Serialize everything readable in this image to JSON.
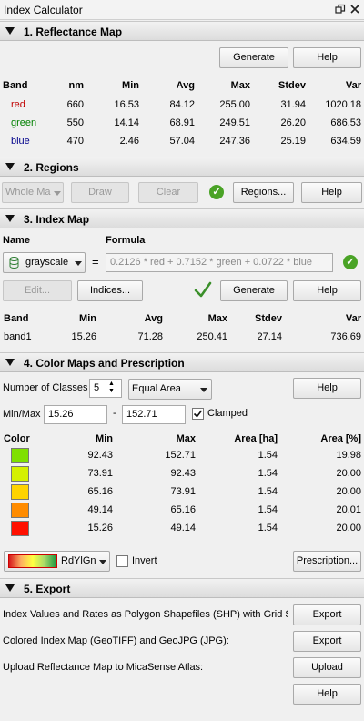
{
  "window": {
    "title": "Index Calculator",
    "restore_icon": "restore-icon",
    "close_icon": "close-icon"
  },
  "s1": {
    "header": "1. Reflectance Map",
    "generate": "Generate",
    "help": "Help",
    "columns": [
      "Band",
      "nm",
      "Min",
      "Avg",
      "Max",
      "Stdev",
      "Var"
    ],
    "rows": [
      {
        "band": "red",
        "color": "#c00000",
        "nm": "660",
        "min": "16.53",
        "avg": "84.12",
        "max": "255.00",
        "stdev": "31.94",
        "var": "1020.18"
      },
      {
        "band": "green",
        "color": "#008000",
        "nm": "550",
        "min": "14.14",
        "avg": "68.91",
        "max": "249.51",
        "stdev": "26.20",
        "var": "686.53"
      },
      {
        "band": "blue",
        "color": "#00008b",
        "nm": "470",
        "min": "2.46",
        "avg": "57.04",
        "max": "247.36",
        "stdev": "25.19",
        "var": "634.59"
      }
    ]
  },
  "s2": {
    "header": "2. Regions",
    "region_select": "Whole Ma",
    "draw": "Draw",
    "clear": "Clear",
    "regions": "Regions...",
    "help": "Help"
  },
  "s3": {
    "header": "3. Index Map",
    "name_label": "Name",
    "formula_label": "Formula",
    "name_value": "grayscale",
    "equals": "=",
    "formula": "0.2126 * red + 0.7152 * green + 0.0722 * blue",
    "edit": "Edit...",
    "indices": "Indices...",
    "generate": "Generate",
    "help": "Help",
    "columns": [
      "Band",
      "Min",
      "Avg",
      "Max",
      "Stdev",
      "Var"
    ],
    "row": {
      "band": "band1",
      "min": "15.26",
      "avg": "71.28",
      "max": "250.41",
      "stdev": "27.14",
      "var": "736.69"
    }
  },
  "s4": {
    "header": "4. Color Maps and Prescription",
    "classes_label": "Number of Classes",
    "classes_value": "5",
    "method": "Equal Area",
    "help": "Help",
    "minmax_label": "Min/Max",
    "min_value": "15.26",
    "dash": "-",
    "max_value": "152.71",
    "clamped": "Clamped",
    "columns": [
      "Color",
      "Min",
      "Max",
      "Area [ha]",
      "Area [%]"
    ],
    "rows": [
      {
        "color": "#7fe000",
        "min": "92.43",
        "max": "152.71",
        "area_ha": "1.54",
        "area_pct": "19.98"
      },
      {
        "color": "#d4f000",
        "min": "73.91",
        "max": "92.43",
        "area_ha": "1.54",
        "area_pct": "20.00"
      },
      {
        "color": "#ffd400",
        "min": "65.16",
        "max": "73.91",
        "area_ha": "1.54",
        "area_pct": "20.00"
      },
      {
        "color": "#ff8c00",
        "min": "49.14",
        "max": "65.16",
        "area_ha": "1.54",
        "area_pct": "20.01"
      },
      {
        "color": "#ff1000",
        "min": "15.26",
        "max": "49.14",
        "area_ha": "1.54",
        "area_pct": "20.00"
      }
    ],
    "colormap": "RdYlGn",
    "invert": "Invert",
    "prescription": "Prescription..."
  },
  "s5": {
    "header": "5. Export",
    "row1_label": "Index Values and Rates as Polygon Shapefiles (SHP) with Grid Size",
    "row1_btn": "Export",
    "row2_label": "Colored Index Map (GeoTIFF) and GeoJPG (JPG):",
    "row2_btn": "Export",
    "row3_label": "Upload Reflectance Map to MicaSense Atlas:",
    "row3_btn": "Upload",
    "help": "Help"
  }
}
